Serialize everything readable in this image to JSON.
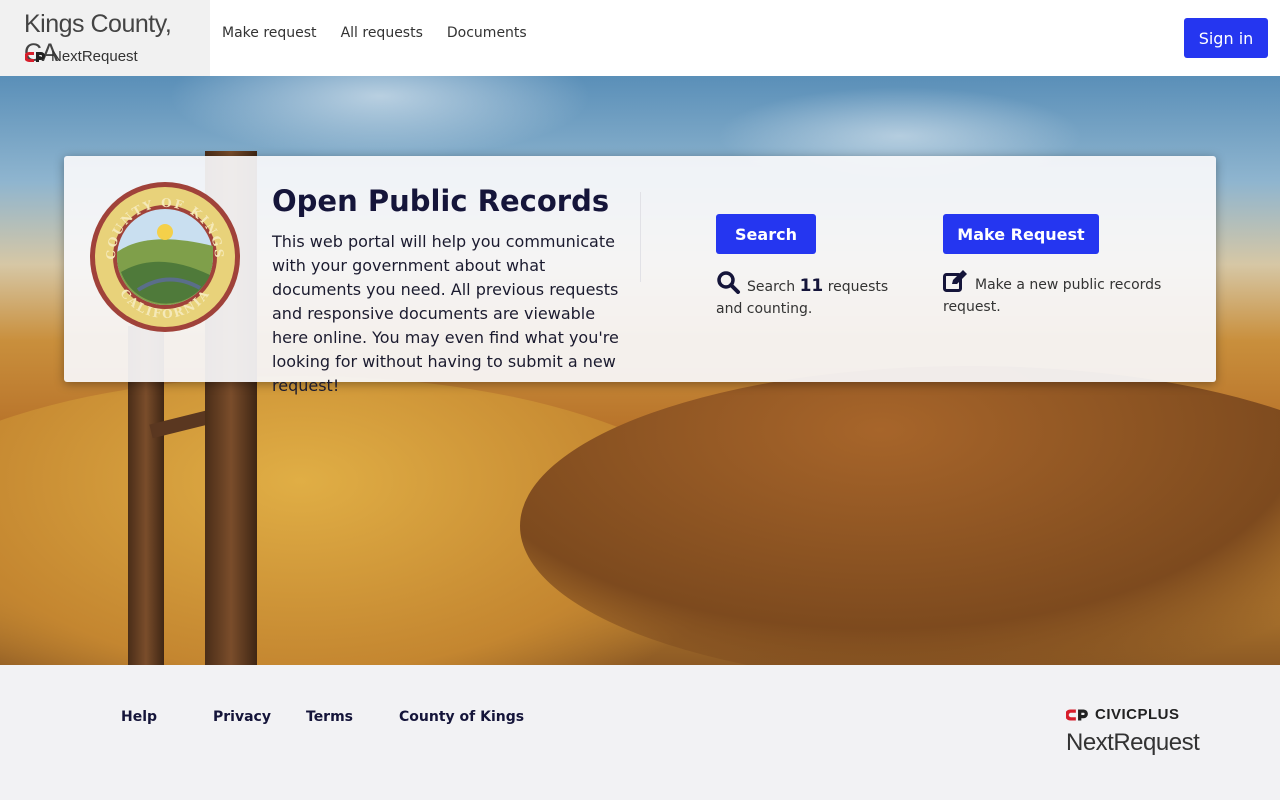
{
  "header": {
    "brand_title": "Kings County, CA",
    "brand_sub": "NextRequest",
    "nav": [
      "Make request",
      "All requests",
      "Documents"
    ],
    "signin_label": "Sign in"
  },
  "hero": {
    "title": "Open Public Records",
    "description": "This web portal will help you communicate with your government about what documents you need. All previous requests and responsive documents are viewable here online. You may even find what you're looking for without having to submit a new request!",
    "seal_text_top": "COUNTY OF KINGS",
    "seal_text_bottom": "CALIFORNIA",
    "search": {
      "button": "Search",
      "prefix": "Search",
      "count": "11",
      "suffix": "requests and counting."
    },
    "make_request": {
      "button": "Make Request",
      "text": "Make a new public records request."
    },
    "icons": [
      "search-icon",
      "edit-icon"
    ]
  },
  "footer": {
    "links": [
      "Help",
      "Privacy",
      "Terms",
      "County of Kings"
    ],
    "civic_logo_text": "CIVICPLUS",
    "nextrequest_label": "NextRequest"
  },
  "colors": {
    "primary": "#2536f0",
    "brand_red": "#d71e2b",
    "title": "#15153a"
  }
}
